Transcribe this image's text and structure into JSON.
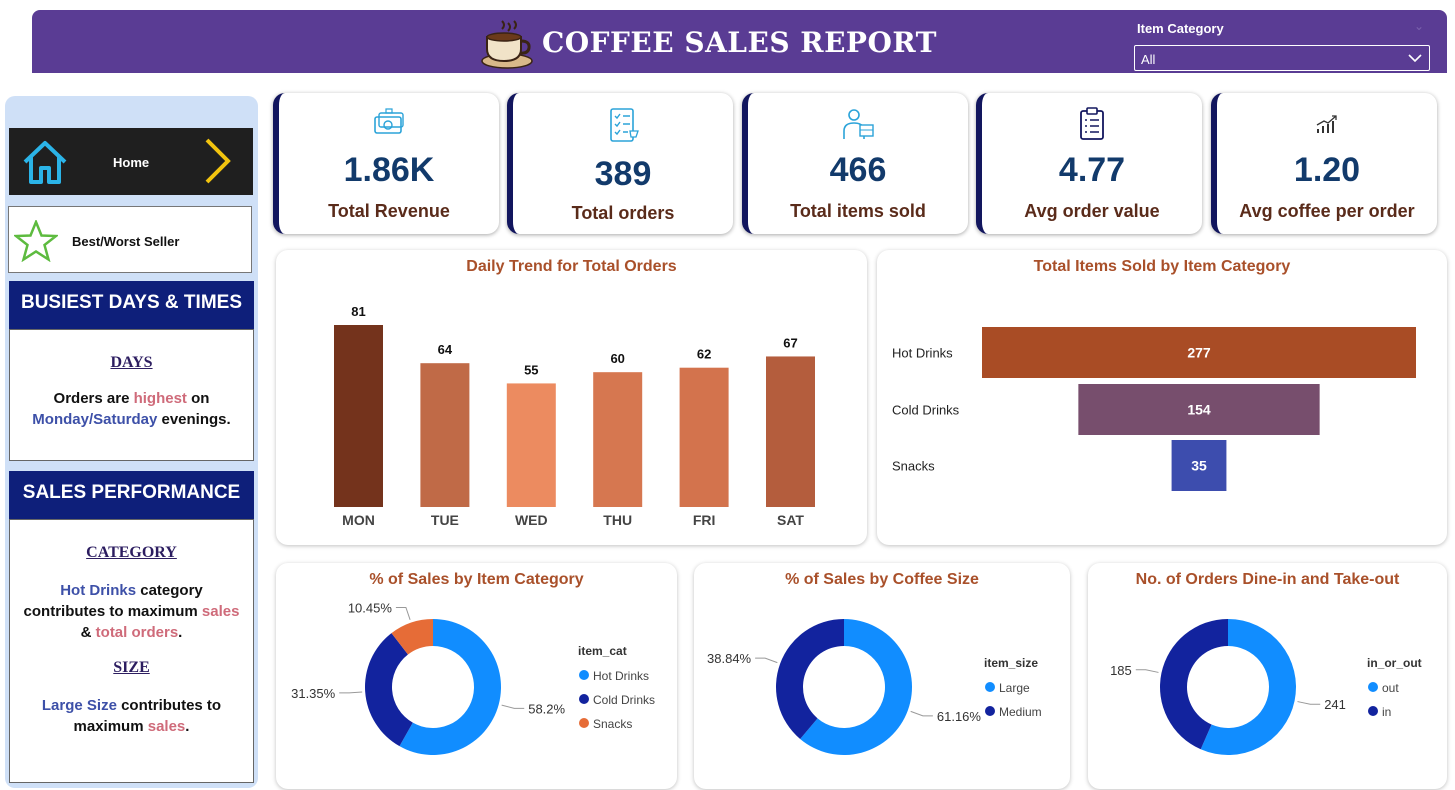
{
  "header": {
    "title": "COFFEE SALES REPORT"
  },
  "filter": {
    "label": "Item Category",
    "selected": "All"
  },
  "nav": {
    "home": "Home",
    "best_worst": "Best/Worst Seller"
  },
  "busiest": {
    "heading": "BUSIEST DAYS & TIMES",
    "sub": "DAYS",
    "text_1": "Orders are ",
    "text_hl_1": "highest",
    "text_2": " on",
    "text_hl_2": "Monday/Saturday",
    "text_3": " evenings."
  },
  "performance": {
    "heading": "SALES PERFORMANCE",
    "category_sub": "CATEGORY",
    "cat_hl_1": "Hot Drinks",
    "cat_text_1": " category",
    "cat_text_2": "contributes to maximum ",
    "cat_hl_2": "sales",
    "cat_text_3": "& ",
    "cat_hl_3": "total orders",
    "cat_text_4": ".",
    "size_sub": "SIZE",
    "size_hl_1": "Large Size",
    "size_text_1": " contributes to",
    "size_text_2": "maximum ",
    "size_hl_2": "sales",
    "size_text_3": "."
  },
  "kpis": [
    {
      "value": "1.86K",
      "label": "Total Revenue",
      "icon": "money-icon"
    },
    {
      "value": "389",
      "label": "Total orders",
      "icon": "checklist-icon"
    },
    {
      "value": "466",
      "label": "Total items sold",
      "icon": "delivery-icon"
    },
    {
      "value": "4.77",
      "label": "Avg order value",
      "icon": "clipboard-icon"
    },
    {
      "value": "1.20",
      "label": "Avg coffee per order",
      "icon": "growth-chart-icon"
    }
  ],
  "colors": {
    "header": "#5a3c94",
    "navy": "#0e1f7a",
    "title_brown": "#a9502a",
    "blue_light": "#118dff",
    "blue_dark": "#12239e",
    "orange": "#e66c37"
  },
  "chart_data": [
    {
      "type": "bar",
      "title": "Daily Trend for Total Orders",
      "categories": [
        "MON",
        "TUE",
        "WED",
        "THU",
        "FRI",
        "SAT"
      ],
      "values": [
        81,
        64,
        55,
        60,
        62,
        67
      ],
      "colors": [
        "#74331c",
        "#c06a47",
        "#ec8b60",
        "#d67750",
        "#d3734d",
        "#b45d3d"
      ],
      "ylim": [
        0,
        81
      ]
    },
    {
      "type": "bar",
      "orientation": "horizontal",
      "title": "Total Items Sold by Item Category",
      "categories": [
        "Hot Drinks",
        "Cold Drinks",
        "Snacks"
      ],
      "values": [
        277,
        154,
        35
      ],
      "colors": [
        "#a94c25",
        "#774e6d",
        "#3d4dae"
      ]
    },
    {
      "type": "pie",
      "title": "% of Sales by Item Category",
      "legend_title": "item_cat",
      "labels": [
        "Hot Drinks",
        "Cold Drinks",
        "Snacks"
      ],
      "values": [
        58.2,
        31.35,
        10.45
      ],
      "value_labels": [
        "58.2%",
        "31.35%",
        "10.45%"
      ],
      "colors": [
        "#118dff",
        "#12239e",
        "#e66c37"
      ]
    },
    {
      "type": "pie",
      "title": "% of Sales by Coffee Size",
      "legend_title": "item_size",
      "labels": [
        "Large",
        "Medium"
      ],
      "values": [
        61.16,
        38.84
      ],
      "value_labels": [
        "61.16%",
        "38.84%"
      ],
      "colors": [
        "#118dff",
        "#12239e"
      ]
    },
    {
      "type": "pie",
      "title": "No. of Orders Dine-in and Take-out",
      "legend_title": "in_or_out",
      "labels": [
        "out",
        "in"
      ],
      "values": [
        241,
        185
      ],
      "value_labels": [
        "241",
        "185"
      ],
      "colors": [
        "#118dff",
        "#12239e"
      ]
    }
  ]
}
